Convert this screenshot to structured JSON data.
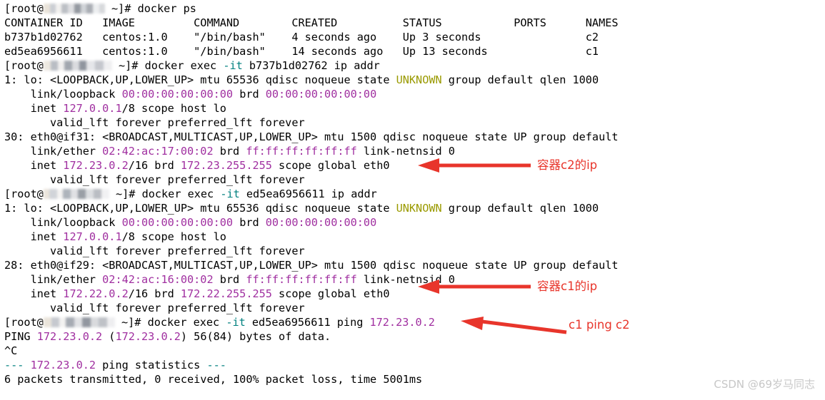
{
  "terminal": {
    "prompt_user": "root",
    "prompt_tail": "~]#",
    "lines": [
      {
        "id": "cmd-docker-ps",
        "kind": "prompt",
        "command": " docker ps"
      },
      {
        "id": "ps-header",
        "kind": "plain",
        "text": "CONTAINER ID   IMAGE         COMMAND        CREATED          STATUS           PORTS      NAMES"
      },
      {
        "id": "ps-row-c2",
        "kind": "plain",
        "text": "b737b1d02762   centos:1.0    \"/bin/bash\"    4 seconds ago    Up 3 seconds                c2"
      },
      {
        "id": "ps-row-c1",
        "kind": "plain",
        "text": "ed5ea6956611   centos:1.0    \"/bin/bash\"    14 seconds ago   Up 13 seconds               c1"
      },
      {
        "id": "cmd-exec-c2-ipaddr",
        "kind": "prompt-exec",
        "pre": " docker exec ",
        "flag": "-it",
        "post": " b737b1d02762 ip addr"
      },
      {
        "id": "c2-lo-if",
        "kind": "seg",
        "segments": [
          {
            "t": "1: lo: <LOOPBACK,UP,LOWER_UP> mtu 65536 qdisc noqueue state ",
            "c": "blk"
          },
          {
            "t": "UNKNOWN",
            "c": "yel"
          },
          {
            "t": " group default qlen 1000",
            "c": "blk"
          }
        ]
      },
      {
        "id": "c2-lo-mac",
        "kind": "seg",
        "segments": [
          {
            "t": "    link/loopback ",
            "c": "blk"
          },
          {
            "t": "00:00:00:00:00:00",
            "c": "mag"
          },
          {
            "t": " brd ",
            "c": "blk"
          },
          {
            "t": "00:00:00:00:00:00",
            "c": "mag"
          }
        ]
      },
      {
        "id": "c2-lo-inet",
        "kind": "seg",
        "segments": [
          {
            "t": "    inet ",
            "c": "blk"
          },
          {
            "t": "127.0.0.1",
            "c": "mag"
          },
          {
            "t": "/8 scope host lo",
            "c": "blk"
          }
        ]
      },
      {
        "id": "c2-lo-lft",
        "kind": "plain",
        "text": "       valid_lft forever preferred_lft forever"
      },
      {
        "id": "c2-eth0-if",
        "kind": "plain",
        "text": "30: eth0@if31: <BROADCAST,MULTICAST,UP,LOWER_UP> mtu 1500 qdisc noqueue state UP group default"
      },
      {
        "id": "c2-eth0-mac",
        "kind": "seg",
        "segments": [
          {
            "t": "    link/ether ",
            "c": "blk"
          },
          {
            "t": "02:42:ac:17:00:02",
            "c": "mag"
          },
          {
            "t": " brd ",
            "c": "blk"
          },
          {
            "t": "ff:ff:ff:ff:ff:ff",
            "c": "mag"
          },
          {
            "t": " link-netnsid 0",
            "c": "blk"
          }
        ]
      },
      {
        "id": "c2-eth0-inet",
        "kind": "seg",
        "segments": [
          {
            "t": "    inet ",
            "c": "blk"
          },
          {
            "t": "172.23.0.2",
            "c": "mag"
          },
          {
            "t": "/16 brd ",
            "c": "blk"
          },
          {
            "t": "172.23.255.255",
            "c": "mag"
          },
          {
            "t": " scope global eth0",
            "c": "blk"
          }
        ]
      },
      {
        "id": "c2-eth0-lft",
        "kind": "plain",
        "text": "       valid_lft forever preferred_lft forever"
      },
      {
        "id": "cmd-exec-c1-ipaddr",
        "kind": "prompt-exec",
        "pre": " docker exec ",
        "flag": "-it",
        "post": " ed5ea6956611 ip addr"
      },
      {
        "id": "c1-lo-if",
        "kind": "seg",
        "segments": [
          {
            "t": "1: lo: <LOOPBACK,UP,LOWER_UP> mtu 65536 qdisc noqueue state ",
            "c": "blk"
          },
          {
            "t": "UNKNOWN",
            "c": "yel"
          },
          {
            "t": " group default qlen 1000",
            "c": "blk"
          }
        ]
      },
      {
        "id": "c1-lo-mac",
        "kind": "seg",
        "segments": [
          {
            "t": "    link/loopback ",
            "c": "blk"
          },
          {
            "t": "00:00:00:00:00:00",
            "c": "mag"
          },
          {
            "t": " brd ",
            "c": "blk"
          },
          {
            "t": "00:00:00:00:00:00",
            "c": "mag"
          }
        ]
      },
      {
        "id": "c1-lo-inet",
        "kind": "seg",
        "segments": [
          {
            "t": "    inet ",
            "c": "blk"
          },
          {
            "t": "127.0.0.1",
            "c": "mag"
          },
          {
            "t": "/8 scope host lo",
            "c": "blk"
          }
        ]
      },
      {
        "id": "c1-lo-lft",
        "kind": "plain",
        "text": "       valid_lft forever preferred_lft forever"
      },
      {
        "id": "c1-eth0-if",
        "kind": "plain",
        "text": "28: eth0@if29: <BROADCAST,MULTICAST,UP,LOWER_UP> mtu 1500 qdisc noqueue state UP group default"
      },
      {
        "id": "c1-eth0-mac",
        "kind": "seg",
        "segments": [
          {
            "t": "    link/ether ",
            "c": "blk"
          },
          {
            "t": "02:42:ac:16:00:02",
            "c": "mag"
          },
          {
            "t": " brd ",
            "c": "blk"
          },
          {
            "t": "ff:ff:ff:ff:ff:ff",
            "c": "mag"
          },
          {
            "t": " link-netnsid 0",
            "c": "blk"
          }
        ]
      },
      {
        "id": "c1-eth0-inet",
        "kind": "seg",
        "segments": [
          {
            "t": "    inet ",
            "c": "blk"
          },
          {
            "t": "172.22.0.2",
            "c": "mag"
          },
          {
            "t": "/16 brd ",
            "c": "blk"
          },
          {
            "t": "172.22.255.255",
            "c": "mag"
          },
          {
            "t": " scope global eth0",
            "c": "blk"
          }
        ]
      },
      {
        "id": "c1-eth0-lft",
        "kind": "plain",
        "text": "       valid_lft forever preferred_lft forever"
      },
      {
        "id": "cmd-ping",
        "kind": "prompt-exec",
        "pre": " docker exec ",
        "flag": "-it",
        "post": " ed5ea6956611 ping ",
        "tail_mag": "172.23.0.2"
      },
      {
        "id": "ping-banner",
        "kind": "seg",
        "segments": [
          {
            "t": "PING ",
            "c": "blk"
          },
          {
            "t": "172.23.0.2",
            "c": "mag"
          },
          {
            "t": " (",
            "c": "blk"
          },
          {
            "t": "172.23.0.2",
            "c": "mag"
          },
          {
            "t": ") 56(84) bytes of data.",
            "c": "blk"
          }
        ]
      },
      {
        "id": "ping-interrupt",
        "kind": "plain",
        "text": "^C"
      },
      {
        "id": "ping-stats-header",
        "kind": "seg",
        "segments": [
          {
            "t": "--- ",
            "c": "teal"
          },
          {
            "t": "172.23.0.2",
            "c": "mag"
          },
          {
            "t": " ping statistics ",
            "c": "blk"
          },
          {
            "t": "---",
            "c": "teal"
          }
        ]
      },
      {
        "id": "ping-stats-line",
        "kind": "plain",
        "text": "6 packets transmitted, 0 received, 100% packet loss, time 5001ms"
      }
    ]
  },
  "annotations": [
    {
      "id": "anno-c2-ip",
      "label": "容器c2的ip"
    },
    {
      "id": "anno-c1-ip",
      "label": "容器c1的ip"
    },
    {
      "id": "anno-ping",
      "label": "c1 ping c2"
    }
  ],
  "watermark": {
    "text": "CSDN @69岁马同志"
  },
  "colors": {
    "magenta": "#a02fa0",
    "teal": "#00807f",
    "yellow": "#9a9a00",
    "annotation_red": "#e8352b",
    "background": "#ffffff",
    "foreground": "#000000"
  }
}
